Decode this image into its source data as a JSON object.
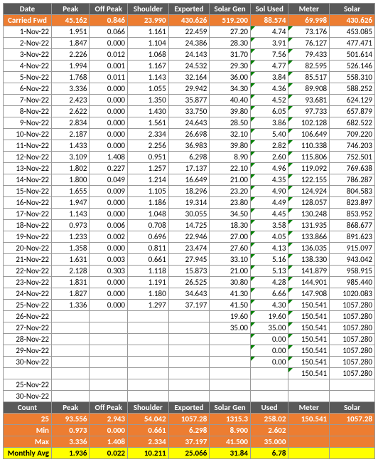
{
  "columns": [
    "Date",
    "Peak",
    "Off Peak",
    "Shoulder",
    "Exported",
    "Solar Gen",
    "Sol Used",
    "Meter",
    "Solar"
  ],
  "carried_label": "Carried Fwd",
  "carried": [
    "45.162",
    "0.846",
    "23.990",
    "430.626",
    "519.200",
    "88.574",
    "69.998",
    "430.626"
  ],
  "rows": [
    {
      "d": "1-Nov-22",
      "v": [
        "1.951",
        "0.066",
        "1.161",
        "22.459",
        "27.20",
        "4.74",
        "73.176",
        "453.085"
      ]
    },
    {
      "d": "2-Nov-22",
      "v": [
        "1.847",
        "0.000",
        "1.104",
        "24.386",
        "28.30",
        "3.91",
        "76.127",
        "477.471"
      ]
    },
    {
      "d": "3-Nov-22",
      "v": [
        "2.226",
        "0.012",
        "1.068",
        "24.143",
        "31.70",
        "7.56",
        "79.433",
        "501.614"
      ]
    },
    {
      "d": "4-Nov-22",
      "v": [
        "1.994",
        "0.001",
        "1.167",
        "24.532",
        "29.30",
        "4.77",
        "82.595",
        "526.146"
      ]
    },
    {
      "d": "5-Nov-22",
      "v": [
        "1.768",
        "0.011",
        "1.143",
        "32.164",
        "36.00",
        "3.84",
        "85.517",
        "558.310"
      ]
    },
    {
      "d": "6-Nov-22",
      "v": [
        "3.336",
        "0.000",
        "1.055",
        "29.942",
        "34.30",
        "4.36",
        "89.908",
        "588.252"
      ]
    },
    {
      "d": "7-Nov-22",
      "v": [
        "2.423",
        "0.000",
        "1.350",
        "35.877",
        "40.40",
        "4.52",
        "93.681",
        "624.129"
      ]
    },
    {
      "d": "8-Nov-22",
      "v": [
        "2.622",
        "0.000",
        "1.430",
        "33.750",
        "39.80",
        "6.05",
        "97.733",
        "657.879"
      ]
    },
    {
      "d": "9-Nov-22",
      "v": [
        "2.834",
        "0.000",
        "1.561",
        "24.643",
        "28.50",
        "3.86",
        "102.128",
        "682.522"
      ]
    },
    {
      "d": "10-Nov-22",
      "v": [
        "2.187",
        "0.000",
        "2.334",
        "26.698",
        "32.10",
        "5.40",
        "106.649",
        "709.220"
      ]
    },
    {
      "d": "11-Nov-22",
      "v": [
        "1.433",
        "0.000",
        "2.256",
        "36.983",
        "39.80",
        "2.82",
        "110.338",
        "746.203"
      ]
    },
    {
      "d": "12-Nov-22",
      "v": [
        "3.109",
        "1.408",
        "0.951",
        "6.298",
        "8.90",
        "2.60",
        "115.806",
        "752.501"
      ]
    },
    {
      "d": "13-Nov-22",
      "v": [
        "1.802",
        "0.227",
        "1.257",
        "17.137",
        "22.10",
        "4.96",
        "119.092",
        "769.638"
      ]
    },
    {
      "d": "14-Nov-22",
      "v": [
        "1.800",
        "0.049",
        "1.214",
        "16.649",
        "21.00",
        "4.35",
        "122.155",
        "786.287"
      ]
    },
    {
      "d": "15-Nov-22",
      "v": [
        "1.655",
        "0.009",
        "1.105",
        "18.296",
        "23.20",
        "4.90",
        "124.924",
        "804.583"
      ]
    },
    {
      "d": "16-Nov-22",
      "v": [
        "1.947",
        "0.000",
        "1.186",
        "19.314",
        "23.80",
        "4.49",
        "128.057",
        "823.897"
      ]
    },
    {
      "d": "17-Nov-22",
      "v": [
        "1.143",
        "0.000",
        "1.048",
        "30.055",
        "34.50",
        "4.45",
        "130.248",
        "853.952"
      ]
    },
    {
      "d": "18-Nov-22",
      "v": [
        "0.973",
        "0.006",
        "0.708",
        "14.725",
        "18.30",
        "3.58",
        "131.935",
        "868.677"
      ]
    },
    {
      "d": "19-Nov-22",
      "v": [
        "1.233",
        "0.002",
        "0.696",
        "22.946",
        "27.00",
        "4.05",
        "133.866",
        "891.623"
      ]
    },
    {
      "d": "20-Nov-22",
      "v": [
        "1.358",
        "0.000",
        "0.811",
        "23.474",
        "27.60",
        "4.13",
        "136.035",
        "915.097"
      ]
    },
    {
      "d": "21-Nov-22",
      "v": [
        "1.631",
        "0.003",
        "0.661",
        "27.945",
        "33.10",
        "5.16",
        "138.330",
        "943.042"
      ]
    },
    {
      "d": "22-Nov-22",
      "v": [
        "2.128",
        "0.303",
        "1.118",
        "15.873",
        "21.00",
        "5.13",
        "141.879",
        "958.915"
      ]
    },
    {
      "d": "23-Nov-22",
      "v": [
        "1.831",
        "0.000",
        "1.191",
        "26.525",
        "30.80",
        "4.28",
        "144.901",
        "985.440"
      ]
    },
    {
      "d": "24-Nov-22",
      "v": [
        "1.827",
        "0.000",
        "1.180",
        "34.643",
        "41.30",
        "6.66",
        "147.908",
        "1020.083"
      ]
    },
    {
      "d": "25-Nov-22",
      "v": [
        "1.336",
        "0.000",
        "1.297",
        "37.197",
        "41.50",
        "4.30",
        "150.541",
        "1057.280"
      ]
    },
    {
      "d": "26-Nov-22",
      "v": [
        "",
        "",
        "",
        "",
        "19.60",
        "19.60",
        "150.541",
        "1057.280"
      ]
    },
    {
      "d": "27-Nov-22",
      "v": [
        "",
        "",
        "",
        "",
        "35.00",
        "35.00",
        "150.541",
        "1057.280"
      ]
    },
    {
      "d": "28-Nov-22",
      "v": [
        "",
        "",
        "",
        "",
        "",
        "0.00",
        "150.541",
        "1057.280"
      ]
    },
    {
      "d": "29-Nov-22",
      "v": [
        "",
        "",
        "",
        "",
        "",
        "0.00",
        "150.541",
        "1057.280"
      ]
    },
    {
      "d": "30-Nov-22",
      "v": [
        "",
        "",
        "",
        "",
        "",
        "0.00",
        "150.541",
        "1057.280"
      ]
    },
    {
      "d": "",
      "v": [
        "",
        "",
        "",
        "",
        "",
        "",
        "150.541",
        "1057.280"
      ]
    },
    {
      "d": "25-Nov-22",
      "v": [
        "",
        "",
        "",
        "",
        "",
        "",
        "",
        ""
      ]
    },
    {
      "d": "30-Nov-22",
      "v": [
        "",
        "",
        "",
        "",
        "",
        "",
        "",
        ""
      ]
    }
  ],
  "summary_header": [
    "Count",
    "Peak",
    "Off Peak",
    "Shoulder",
    "Exported",
    "Solar Gen",
    "Used",
    "Meter",
    "Solar"
  ],
  "summary": [
    {
      "label": "25",
      "cls": "lbl-orange",
      "v": [
        "93.556",
        "2.943",
        "54.042",
        "1057.28",
        "1315.3",
        "258.02",
        "150.541",
        "1057.28"
      ]
    },
    {
      "label": "Min",
      "cls": "lbl-orange",
      "v": [
        "0.973",
        "0.000",
        "0.661",
        "6.298",
        "8.900",
        "2.602",
        "",
        ""
      ]
    },
    {
      "label": "Max",
      "cls": "lbl-orange",
      "v": [
        "3.336",
        "1.408",
        "2.334",
        "37.197",
        "41.500",
        "35.000",
        "",
        ""
      ]
    },
    {
      "label": "Monthly Avg",
      "cls": "lbl-yellow",
      "v": [
        "1.936",
        "0.022",
        "10.211",
        "25.066",
        "31.84",
        "6.78",
        "",
        ""
      ]
    }
  ]
}
